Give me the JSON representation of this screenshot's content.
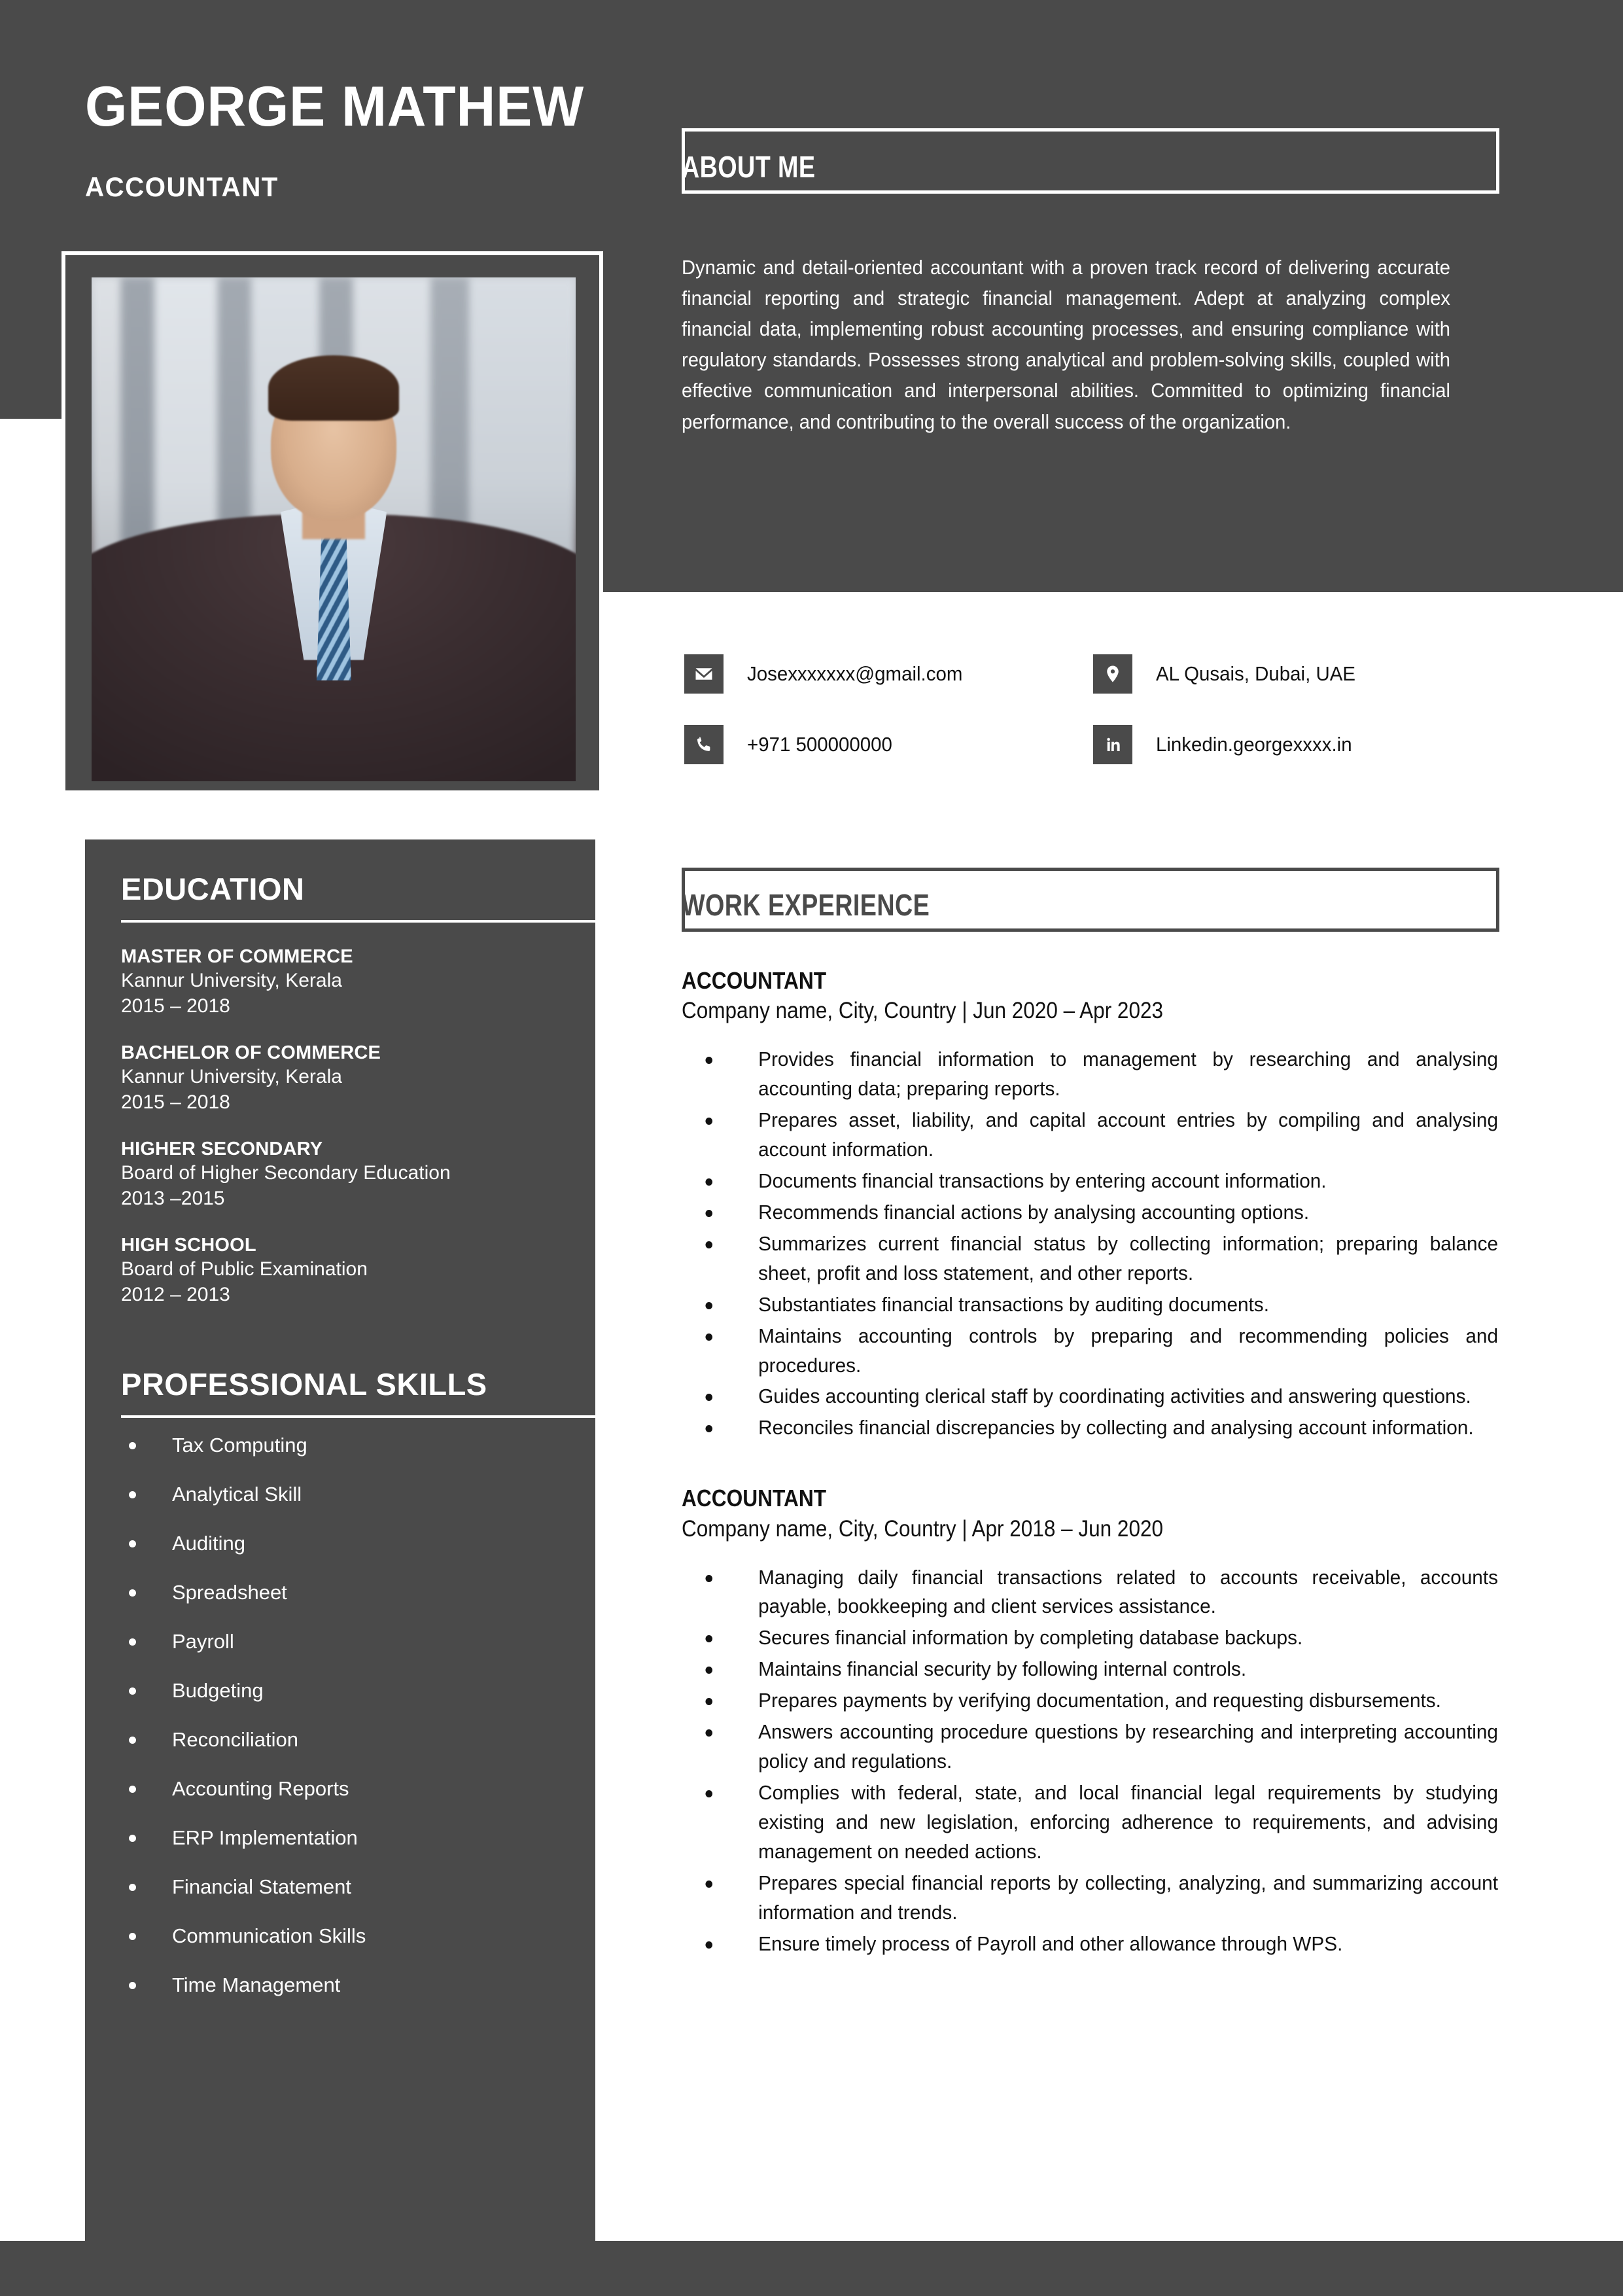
{
  "theme": {
    "dark": "#4a4a4a",
    "light": "#ffffff",
    "text": "#111111"
  },
  "header": {
    "name": "GEORGE MATHEW",
    "role": "ACCOUNTANT",
    "photo_alt": "profile-photo"
  },
  "about": {
    "title": "ABOUT ME",
    "text": "Dynamic and detail-oriented accountant with a proven track record of delivering accurate financial reporting and strategic financial management. Adept at analyzing complex financial data, implementing robust accounting processes, and ensuring compliance with regulatory standards. Possesses strong analytical and problem-solving skills, coupled with effective communication and interpersonal abilities. Committed to optimizing financial performance, and contributing to the overall success of the organization."
  },
  "contact": {
    "email": {
      "icon": "envelope-icon",
      "value": "Josexxxxxxx@gmail.com"
    },
    "location": {
      "icon": "map-pin-icon",
      "value": "AL Qusais, Dubai, UAE"
    },
    "phone": {
      "icon": "phone-icon",
      "value": "+971 500000000"
    },
    "linkedin": {
      "icon": "linkedin-icon",
      "value": "Linkedin.georgexxxx.in"
    }
  },
  "education": {
    "title": "EDUCATION",
    "items": [
      {
        "degree": "MASTER OF COMMERCE",
        "org": "Kannur University, Kerala",
        "years": "2015 – 2018"
      },
      {
        "degree": "BACHELOR OF COMMERCE",
        "org": "Kannur University, Kerala",
        "years": "2015 – 2018"
      },
      {
        "degree": "HIGHER SECONDARY",
        "org": "Board of Higher Secondary Education",
        "years": " 2013 –2015"
      },
      {
        "degree": "HIGH SCHOOL",
        "org": "Board of Public Examination",
        "years": "2012 – 2013"
      }
    ]
  },
  "skills": {
    "title": "PROFESSIONAL SKILLS",
    "items": [
      "Tax Computing",
      "Analytical Skill",
      "Auditing",
      "Spreadsheet",
      "Payroll",
      "Budgeting",
      "Reconciliation",
      "Accounting Reports",
      "ERP Implementation",
      "Financial Statement",
      "Communication Skills",
      "Time Management"
    ]
  },
  "work": {
    "title": "WORK EXPERIENCE",
    "jobs": [
      {
        "role": "ACCOUNTANT",
        "meta": "Company name, City, Country | Jun 2020 – Apr 2023",
        "duties": [
          "Provides financial information to management by researching and analysing accounting data; preparing reports.",
          "Prepares asset, liability, and capital account entries by compiling and analysing account information.",
          "Documents financial transactions by entering account information.",
          "Recommends financial actions by analysing accounting options.",
          "Summarizes current financial status by collecting information; preparing balance sheet, profit and loss statement, and other reports.",
          "Substantiates financial transactions by auditing documents.",
          "Maintains accounting controls by preparing and recommending policies and procedures.",
          "Guides accounting clerical staff by coordinating activities and answering questions.",
          "Reconciles financial discrepancies by collecting and analysing account information."
        ]
      },
      {
        "role": "ACCOUNTANT",
        "meta": "Company name, City, Country | Apr 2018 – Jun 2020",
        "duties": [
          "Managing daily financial transactions related to accounts receivable, accounts payable, bookkeeping and client services assistance.",
          "Secures financial information by completing database backups.",
          "Maintains financial security by following internal controls.",
          "Prepares payments by verifying documentation, and requesting disbursements.",
          "Answers accounting procedure questions by researching and interpreting accounting policy and regulations.",
          "Complies with federal, state, and local financial legal requirements by studying existing and new legislation, enforcing adherence to requirements, and advising management on needed actions.",
          "Prepares special financial reports by collecting, analyzing, and summarizing account information and trends.",
          "Ensure timely process of Payroll and other allowance through WPS."
        ]
      }
    ]
  }
}
